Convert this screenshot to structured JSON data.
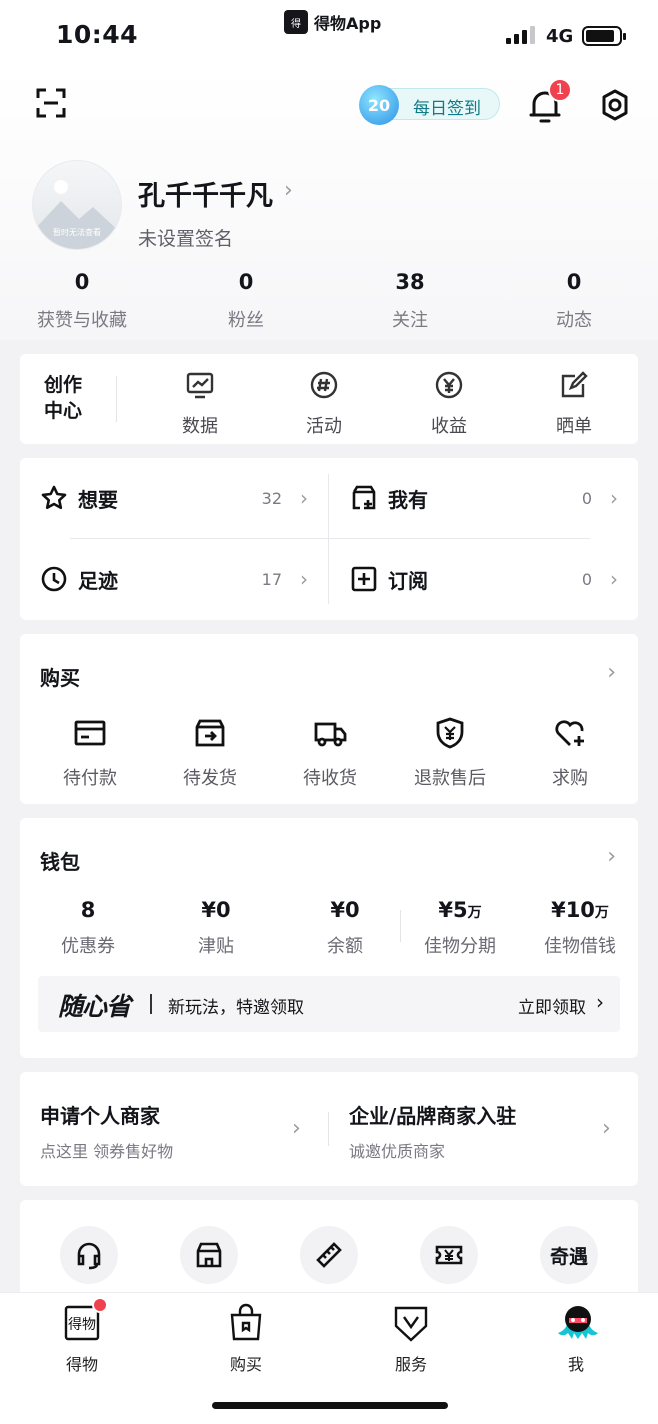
{
  "status_bar": {
    "time": "10:44",
    "app_name": "得物App",
    "network": "4G"
  },
  "header": {
    "checkin_count": "20",
    "checkin_label": "每日签到",
    "notification_count": "1"
  },
  "profile": {
    "avatar_text": "暂时无法查看",
    "username": "孔千千千凡",
    "bio": "未设置签名"
  },
  "stats": [
    {
      "value": "0",
      "label": "获赞与收藏"
    },
    {
      "value": "0",
      "label": "粉丝"
    },
    {
      "value": "38",
      "label": "关注"
    },
    {
      "value": "0",
      "label": "动态"
    }
  ],
  "creator_center": {
    "title_line1": "创作",
    "title_line2": "中心",
    "items": [
      {
        "label": "数据",
        "icon": "chart-icon"
      },
      {
        "label": "活动",
        "icon": "hashtag-icon"
      },
      {
        "label": "收益",
        "icon": "yen-icon"
      },
      {
        "label": "晒单",
        "icon": "edit-icon"
      }
    ]
  },
  "collections": [
    {
      "label": "想要",
      "count": "32",
      "icon": "star-icon"
    },
    {
      "label": "我有",
      "count": "0",
      "icon": "box-plus-icon"
    },
    {
      "label": "足迹",
      "count": "17",
      "icon": "clock-icon"
    },
    {
      "label": "订阅",
      "count": "0",
      "icon": "plus-square-icon"
    }
  ],
  "buy": {
    "title": "购买",
    "items": [
      {
        "label": "待付款",
        "icon": "card-icon"
      },
      {
        "label": "待发货",
        "icon": "box-icon"
      },
      {
        "label": "待收货",
        "icon": "truck-icon"
      },
      {
        "label": "退款售后",
        "icon": "shield-yen-icon"
      },
      {
        "label": "求购",
        "icon": "heart-plus-icon"
      }
    ]
  },
  "wallet": {
    "title": "钱包",
    "items": [
      {
        "value": "8",
        "unit": "",
        "label": "优惠券"
      },
      {
        "value": "¥0",
        "unit": "",
        "label": "津贴"
      },
      {
        "value": "¥0",
        "unit": "",
        "label": "余额"
      },
      {
        "value": "¥5",
        "unit": "万",
        "label": "佳物分期"
      },
      {
        "value": "¥10",
        "unit": "万",
        "label": "佳物借钱"
      }
    ],
    "promo_brand": "随心省",
    "promo_text": "新玩法，特邀领取",
    "promo_cta": "立即领取"
  },
  "merchant": [
    {
      "title": "申请个人商家",
      "subtitle": "点这里 领券售好物"
    },
    {
      "title": "企业/品牌商家入驻",
      "subtitle": "诚邀优质商家"
    }
  ],
  "tools": [
    {
      "icon": "headset-icon"
    },
    {
      "icon": "store-icon"
    },
    {
      "icon": "ruler-icon"
    },
    {
      "icon": "ticket-yen-icon"
    },
    {
      "icon": "qiyu-icon",
      "text": "奇遇"
    }
  ],
  "tabbar": [
    {
      "label": "得物",
      "icon": "dewu-icon",
      "dot": true
    },
    {
      "label": "购买",
      "icon": "bag-icon"
    },
    {
      "label": "服务",
      "icon": "shield-v-icon"
    },
    {
      "label": "我",
      "icon": "me-avatar-icon"
    }
  ],
  "colors": {
    "accent_red": "#f0414f",
    "teal": "#117a86",
    "text_primary": "#14151a"
  }
}
